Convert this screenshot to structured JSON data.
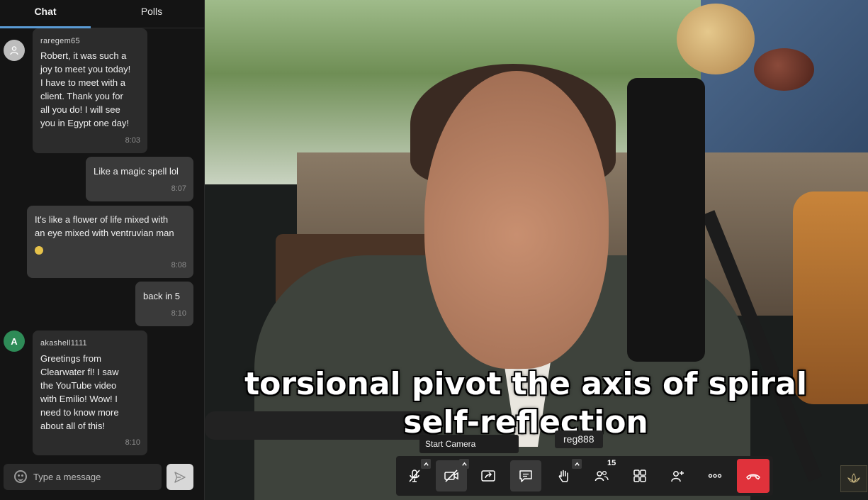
{
  "tabs": {
    "chat": "Chat",
    "polls": "Polls"
  },
  "messages": [
    {
      "sender": "raregem65",
      "avatar": "",
      "text": "Robert, it was such a\njoy to meet you today!\nI have to meet with a\nclient. Thank you for\nall you do! I will see\nyou in Egypt one day!",
      "time": "8:03"
    },
    {
      "text": "Like a magic spell lol",
      "time": "8:07"
    },
    {
      "text": "It's like a flower of life mixed with\nan eye mixed with ventruvian man",
      "time": "8:08"
    },
    {
      "text": "back in 5",
      "time": "8:10"
    },
    {
      "sender": "akashell1111",
      "avatar": "A",
      "text": "Greetings from\nClearwater fl!  I saw\nthe YouTube video\nwith Emilio! Wow! I\nneed to know more\nabout all of this!",
      "time": "8:10"
    }
  ],
  "composer": {
    "placeholder": "Type a message"
  },
  "video": {
    "caption_line1": "torsional pivot the axis of spiral",
    "caption_line2": "self-reflection",
    "name_tag": "reg888",
    "tooltip": "Start Camera"
  },
  "toolbar": {
    "participants_count": "15"
  },
  "colors": {
    "accent": "#5a9bd5",
    "end_call": "#e0323b",
    "bubble": "#2c2c2c",
    "panel": "#141414"
  }
}
